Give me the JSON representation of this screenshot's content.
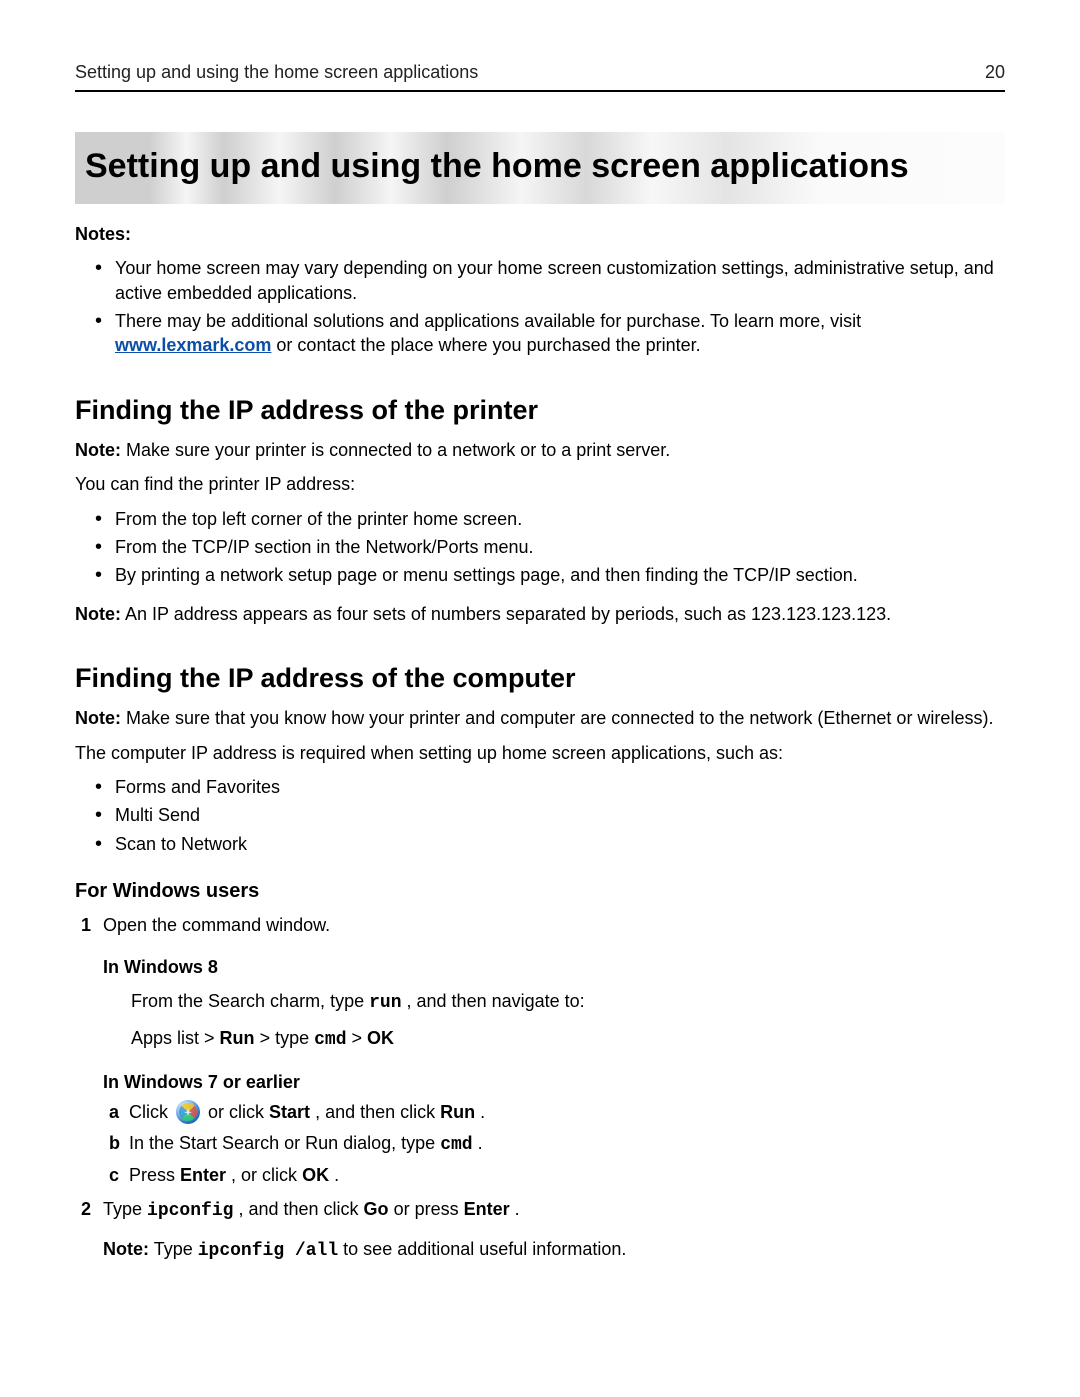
{
  "header": {
    "running_title": "Setting up and using the home screen applications",
    "page_number": "20"
  },
  "title": "Setting up and using the home screen applications",
  "notes_label": "Notes:",
  "notes": [
    "Your home screen may vary depending on your home screen customization settings, administrative setup, and active embedded applications.",
    "There may be additional solutions and applications available for purchase. To learn more, visit ",
    " or contact the place where you purchased the printer."
  ],
  "link": {
    "text": "www.lexmark.com"
  },
  "sec1": {
    "heading": "Finding the IP address of the printer",
    "note_label": "Note:",
    "note_text": " Make sure your printer is connected to a network or to a print server.",
    "intro": "You can find the printer IP address:",
    "bullets": [
      "From the top left corner of the printer home screen.",
      "From the TCP/IP section in the Network/Ports menu.",
      "By printing a network setup page or menu settings page, and then finding the TCP/IP section."
    ],
    "note2_label": "Note:",
    "note2_text": " An IP address appears as four sets of numbers separated by periods, such as 123.123.123.123."
  },
  "sec2": {
    "heading": "Finding the IP address of the computer",
    "note_label": "Note:",
    "note_text": " Make sure that you know how your printer and computer are connected to the network (Ethernet or wireless).",
    "intro": "The computer IP address is required when setting up home screen applications, such as:",
    "bullets": [
      "Forms and Favorites",
      "Multi Send",
      "Scan to Network"
    ],
    "windows_heading": "For Windows users",
    "step1": "Open the command window.",
    "win8_heading": "In Windows 8",
    "win8_line1_pre": "From the Search charm, type ",
    "win8_line1_run": "run",
    "win8_line1_post": ", and then navigate to:",
    "win8_line2_a": "Apps list > ",
    "win8_line2_b": "Run",
    "win8_line2_c": " > type ",
    "win8_line2_d": "cmd",
    "win8_line2_e": " > ",
    "win8_line2_f": "OK",
    "win7_heading": "In Windows 7 or earlier",
    "win7_a_pre": "Click ",
    "win7_a_mid": " or click ",
    "win7_a_start": "Start",
    "win7_a_mid2": ", and then click ",
    "win7_a_run": "Run",
    "win7_a_post": ".",
    "win7_b_pre": "In the Start Search or Run dialog, type ",
    "win7_b_cmd": "cmd",
    "win7_b_post": ".",
    "win7_c_pre": "Press ",
    "win7_c_enter": "Enter",
    "win7_c_mid": ", or click ",
    "win7_c_ok": "OK",
    "win7_c_post": ".",
    "step2_pre": "Type ",
    "step2_ipconfig": "ipconfig",
    "step2_mid": ", and then click ",
    "step2_go": "Go",
    "step2_mid2": " or press ",
    "step2_enter": "Enter",
    "step2_post": ".",
    "step2_note_label": "Note:",
    "step2_note_pre": " Type ",
    "step2_note_cmd": "ipconfig /all",
    "step2_note_post": " to see additional useful information."
  }
}
